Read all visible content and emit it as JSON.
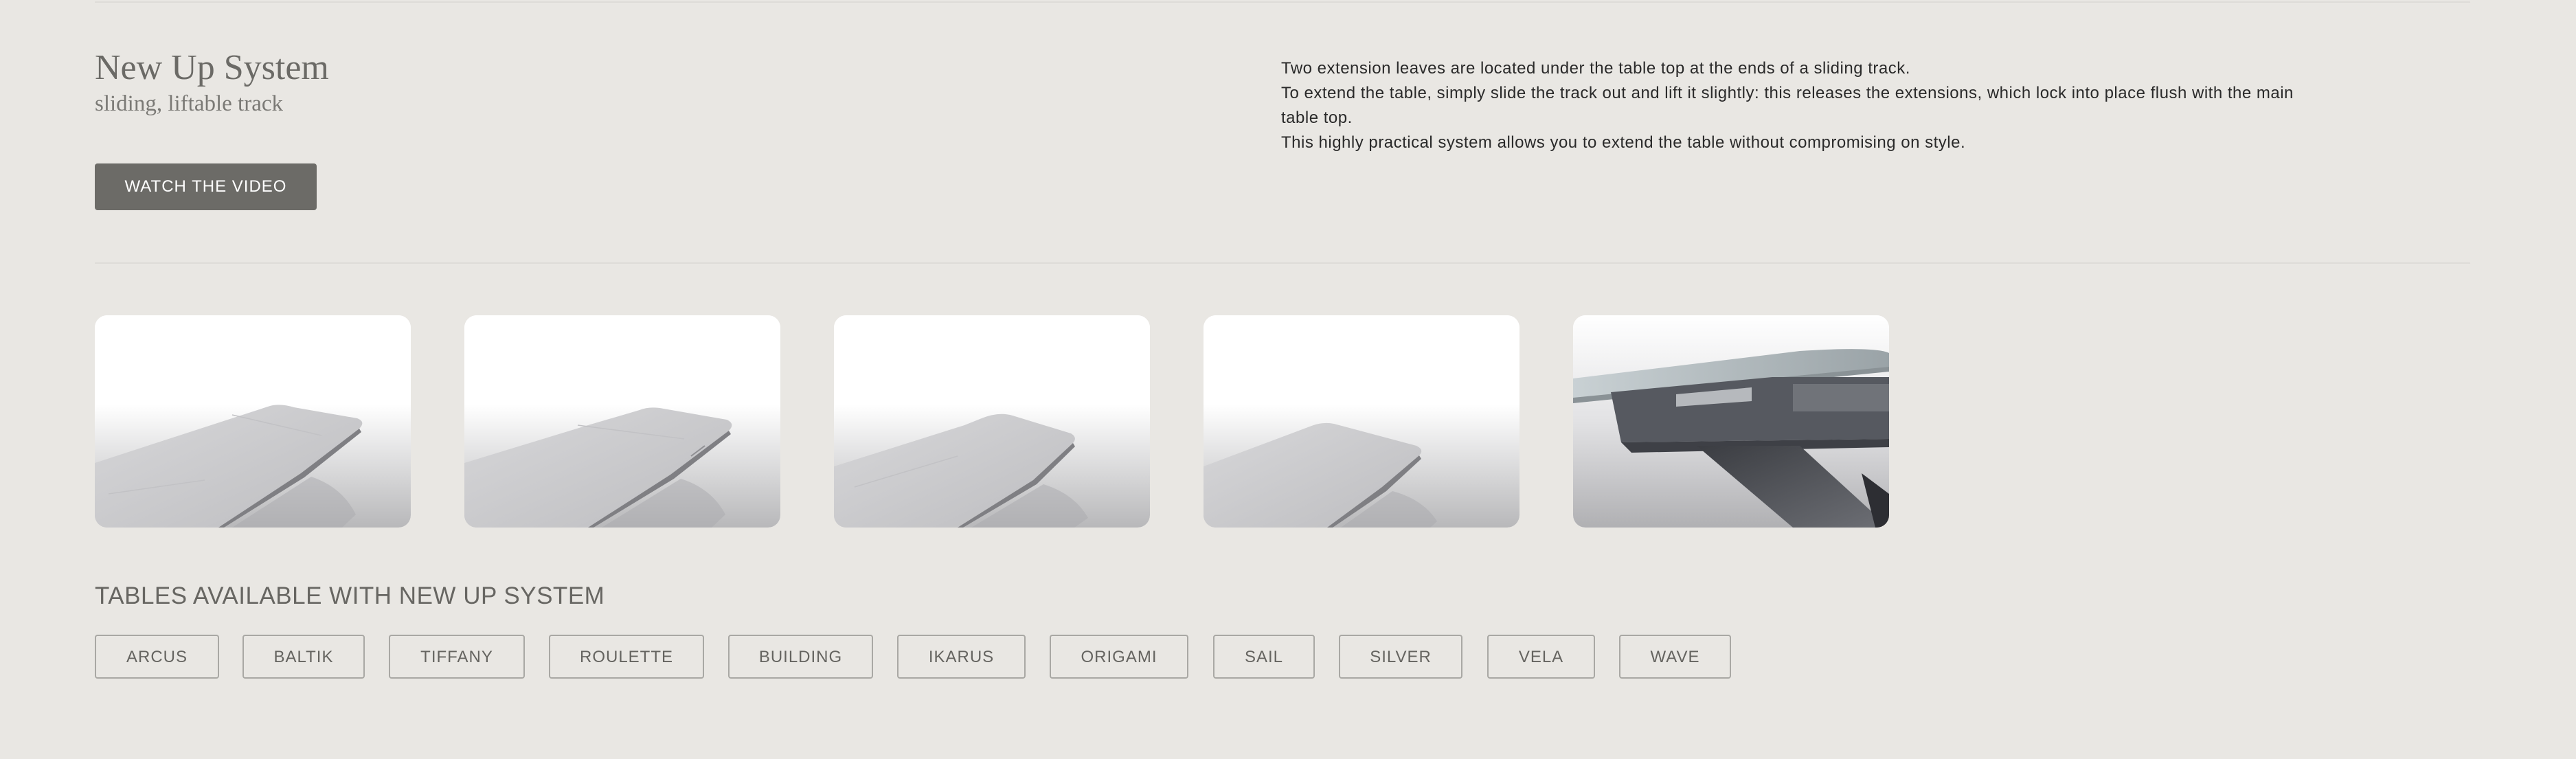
{
  "section": {
    "title": "New Up System",
    "subtitle": "sliding, liftable track",
    "video_button_label": "WATCH THE VIDEO"
  },
  "description": {
    "lines": [
      "Two extension leaves are located under the table top at the ends of a sliding track.",
      "To extend the table, simply slide the track out and lift it slightly: this releases the extensions, which lock into place flush with the main table top.",
      "This highly practical system allows you to extend the table without compromising on style."
    ]
  },
  "gallery": {
    "images": [
      {
        "icon": "table-extension-step-1-image"
      },
      {
        "icon": "table-extension-step-2-image"
      },
      {
        "icon": "table-extension-step-3-image"
      },
      {
        "icon": "table-extension-step-4-image"
      },
      {
        "icon": "sliding-track-mechanism-image"
      }
    ]
  },
  "tables": {
    "heading": "TABLES AVAILABLE WITH NEW UP SYSTEM",
    "items": [
      "ARCUS",
      "BALTIK",
      "TIFFANY",
      "ROULETTE",
      "BUILDING",
      "IKARUS",
      "ORIGAMI",
      "SAIL",
      "SILVER",
      "VELA",
      "WAVE"
    ]
  },
  "colors": {
    "background": "#e9e7e3",
    "button": "#6c6b67",
    "tag_border": "#a9a8a4"
  }
}
